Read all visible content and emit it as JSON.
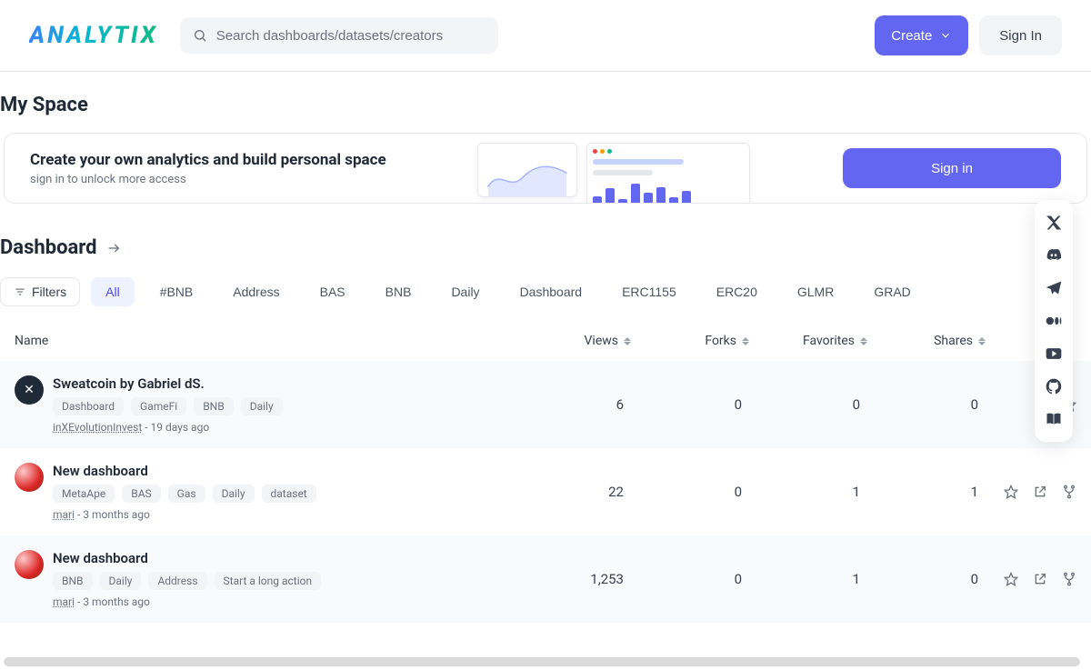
{
  "header": {
    "logo": "ANALYTIX",
    "search_placeholder": "Search dashboards/datasets/creators",
    "create_label": "Create",
    "signin_label": "Sign In"
  },
  "my_space": {
    "title": "My Space",
    "banner_title": "Create your own analytics and build personal space",
    "banner_sub": "sign in to unlock more access",
    "banner_btn": "Sign in"
  },
  "dashboard_section": {
    "title": "Dashboard",
    "filters_label": "Filters",
    "chips": [
      "All",
      "#BNB",
      "Address",
      "BAS",
      "BNB",
      "Daily",
      "Dashboard",
      "ERC1155",
      "ERC20",
      "GLMR",
      "GRAD"
    ],
    "active_chip_index": 0
  },
  "columns": {
    "name": "Name",
    "views": "Views",
    "forks": "Forks",
    "favorites": "Favorites",
    "shares": "Shares"
  },
  "rows": [
    {
      "title": "Sweatcoin by Gabriel dS.",
      "tags": [
        "Dashboard",
        "GameFi",
        "BNB",
        "Daily"
      ],
      "author": "inXEvolutionInvest",
      "age": "19 days ago",
      "views": "6",
      "forks": "0",
      "favorites": "0",
      "shares": "0",
      "avatar_type": "dark",
      "show_extra_actions": false
    },
    {
      "title": "New dashboard",
      "tags": [
        "MetaApe",
        "BAS",
        "Gas",
        "Daily",
        "dataset"
      ],
      "author": "mari",
      "age": "3 months ago",
      "views": "22",
      "forks": "0",
      "favorites": "1",
      "shares": "1",
      "avatar_type": "food",
      "show_extra_actions": true
    },
    {
      "title": "New dashboard",
      "tags": [
        "BNB",
        "Daily",
        "Address",
        "Start a long action"
      ],
      "author": "mari",
      "age": "3 months ago",
      "views": "1,253",
      "forks": "0",
      "favorites": "1",
      "shares": "0",
      "avatar_type": "food",
      "show_extra_actions": true
    }
  ],
  "social": [
    "x",
    "discord",
    "telegram",
    "medium",
    "youtube",
    "github",
    "book"
  ]
}
